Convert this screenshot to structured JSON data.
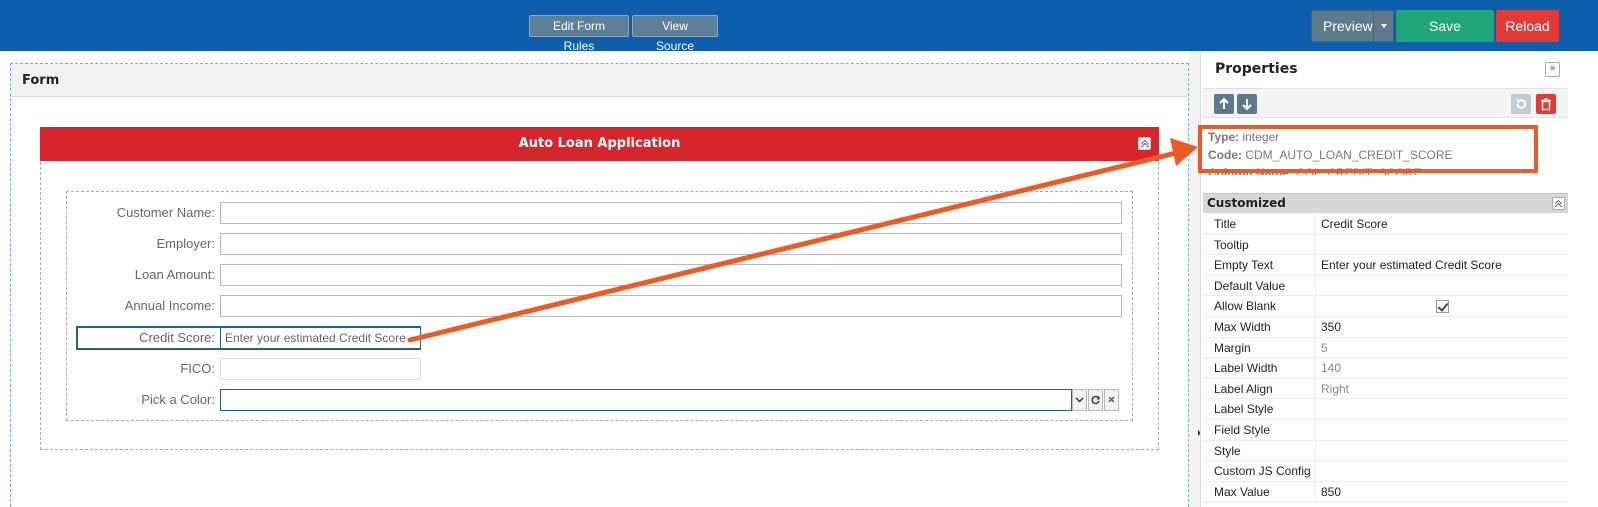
{
  "toolbar": {
    "edit_rules_label": "Edit Form Rules",
    "view_source_label": "View Source",
    "preview_label": "Preview",
    "save_label": "Save",
    "reload_label": "Reload"
  },
  "form": {
    "panel_title": "Form",
    "section_title": "Auto Loan Application",
    "fields": [
      {
        "label": "Customer Name:",
        "value": ""
      },
      {
        "label": "Employer:",
        "value": ""
      },
      {
        "label": "Loan Amount:",
        "value": ""
      },
      {
        "label": "Annual Income:",
        "value": ""
      },
      {
        "label": "Credit Score:",
        "value": "Enter your estimated Credit Score"
      },
      {
        "label": "FICO:",
        "value": ""
      },
      {
        "label": "Pick a Color:",
        "value": ""
      }
    ]
  },
  "properties": {
    "title": "Properties",
    "meta": {
      "type_label": "Type:",
      "type_value": "integer",
      "code_label": "Code:",
      "code_value": "CDM_AUTO_LOAN_CREDIT_SCORE",
      "column_label": "Column Name:",
      "column_value": "COL_CREDIT_SCORE"
    },
    "customized_title": "Customized",
    "rows": [
      {
        "name": "Title",
        "value": "Credit Score"
      },
      {
        "name": "Tooltip",
        "value": ""
      },
      {
        "name": "Empty Text",
        "value": "Enter your estimated Credit Score"
      },
      {
        "name": "Default Value",
        "value": ""
      },
      {
        "name": "Allow Blank",
        "value": ""
      },
      {
        "name": "Max Width",
        "value": "350"
      },
      {
        "name": "Margin",
        "value": "5"
      },
      {
        "name": "Label Width",
        "value": "140"
      },
      {
        "name": "Label Align",
        "value": "Right"
      },
      {
        "name": "Label Style",
        "value": ""
      },
      {
        "name": "Field Style",
        "value": ""
      },
      {
        "name": "Style",
        "value": ""
      },
      {
        "name": "Custom JS Config",
        "value": ""
      },
      {
        "name": "Max Value",
        "value": "850"
      }
    ],
    "allow_blank_checked": true
  },
  "colors": {
    "topbar": "#0b5fad",
    "section_header": "#d6252d",
    "save": "#1fa67a",
    "reload": "#e53935",
    "annotation": "#ef5a24"
  }
}
